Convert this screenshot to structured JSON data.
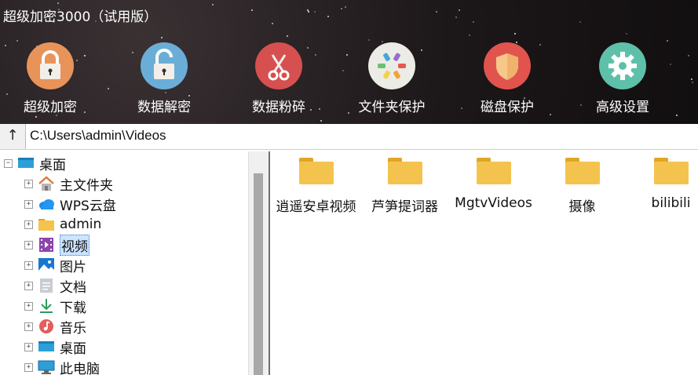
{
  "window": {
    "title": "超级加密3000（试用版）"
  },
  "toolbar": [
    {
      "label": "超级加密",
      "icon": "padlock-locked-icon",
      "color": "#e8935a"
    },
    {
      "label": "数据解密",
      "icon": "padlock-unlocked-icon",
      "color": "#6aaed8"
    },
    {
      "label": "数据粉碎",
      "icon": "scissors-icon",
      "color": "#d6504f"
    },
    {
      "label": "文件夹保护",
      "icon": "color-wheel-icon",
      "color": "#ecece6"
    },
    {
      "label": "磁盘保护",
      "icon": "shield-icon",
      "color": "#e1544e"
    },
    {
      "label": "高级设置",
      "icon": "gear-icon",
      "color": "#5fc0a9"
    }
  ],
  "pathbar": {
    "up_label": "↑",
    "path": "C:\\Users\\admin\\Videos"
  },
  "tree": [
    {
      "label": "桌面",
      "icon": "desktop-icon",
      "expander": "−",
      "level": 0
    },
    {
      "label": "主文件夹",
      "icon": "home-icon",
      "expander": "+",
      "level": 1
    },
    {
      "label": "WPS云盘",
      "icon": "cloud-icon",
      "expander": "+",
      "level": 1
    },
    {
      "label": "admin",
      "icon": "folder-icon",
      "expander": "+",
      "level": 1
    },
    {
      "label": "视频",
      "icon": "video-icon",
      "expander": "+",
      "level": 1,
      "selected": true
    },
    {
      "label": "图片",
      "icon": "picture-icon",
      "expander": "+",
      "level": 1
    },
    {
      "label": "文档",
      "icon": "document-icon",
      "expander": "+",
      "level": 1
    },
    {
      "label": "下载",
      "icon": "download-icon",
      "expander": "+",
      "level": 1
    },
    {
      "label": "音乐",
      "icon": "music-icon",
      "expander": "+",
      "level": 1
    },
    {
      "label": "桌面",
      "icon": "desktop-icon",
      "expander": "+",
      "level": 1
    },
    {
      "label": "此电脑",
      "icon": "computer-icon",
      "expander": "+",
      "level": 1
    }
  ],
  "files": [
    {
      "name": "逍遥安卓视频"
    },
    {
      "name": "芦笋提词器"
    },
    {
      "name": "MgtvVideos"
    },
    {
      "name": "摄像"
    },
    {
      "name": "bilibili"
    }
  ]
}
